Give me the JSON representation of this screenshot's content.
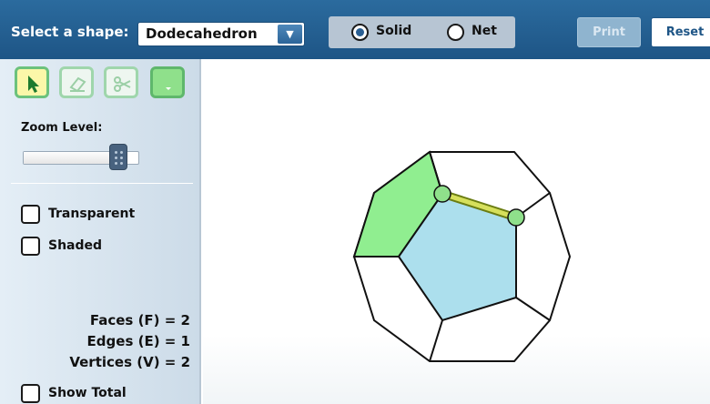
{
  "header": {
    "select_label": "Select a shape:",
    "shape_value": "Dodecahedron",
    "view_options": [
      {
        "label": "Solid",
        "selected": true
      },
      {
        "label": "Net",
        "selected": false
      }
    ],
    "print_label": "Print",
    "reset_label": "Reset"
  },
  "sidebar": {
    "tools": [
      {
        "icon": "arrow-pointer-icon",
        "active": true
      },
      {
        "icon": "eraser-icon",
        "active": false
      },
      {
        "icon": "scissors-icon",
        "active": false
      },
      {
        "icon": "color-dropdown-icon",
        "active": false
      }
    ],
    "zoom_label": "Zoom Level:",
    "zoom_level": 0.82,
    "transparent_label": "Transparent",
    "shaded_label": "Shaded",
    "faces_text": "Faces (F) = 2",
    "edges_text": "Edges (E) = 1",
    "vertices_text": "Vertices (V) = 2",
    "show_total_label": "Show Total"
  },
  "colors": {
    "header": "#1e5586",
    "face_green": "#90ee90",
    "face_blue": "#acdfed",
    "edge_highlight": "#d6e05c",
    "vertex_highlight": "#8fe08b"
  }
}
